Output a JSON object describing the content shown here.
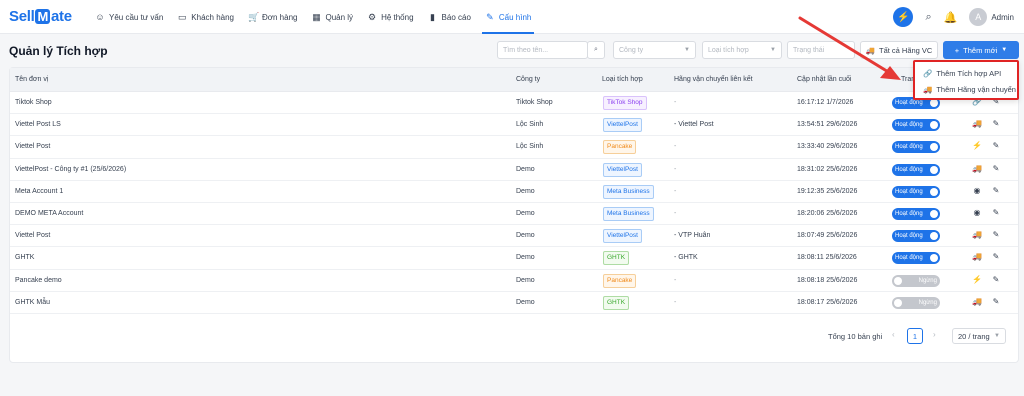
{
  "app": {
    "logo_part1": "Sell",
    "logo_m": "M",
    "logo_part2": "ate"
  },
  "nav": [
    {
      "icon": "☺",
      "icon_name": "smile-icon",
      "label": "Yêu cầu tư vấn"
    },
    {
      "icon": "▭",
      "icon_name": "customers-icon",
      "label": "Khách hàng"
    },
    {
      "icon": "🛒",
      "icon_name": "cart-icon",
      "label": "Đơn hàng"
    },
    {
      "icon": "▦",
      "icon_name": "grid-icon",
      "label": "Quản lý"
    },
    {
      "icon": "⚙",
      "icon_name": "settings-icon",
      "label": "Hệ thống"
    },
    {
      "icon": "▮",
      "icon_name": "report-icon",
      "label": "Báo cáo"
    },
    {
      "icon": "✎",
      "icon_name": "config-icon",
      "label": "Cấu hình"
    }
  ],
  "user": {
    "initial": "A",
    "name": "Admin"
  },
  "page": {
    "title": "Quản lý Tích hợp"
  },
  "filters": {
    "search_placeholder": "Tìm theo tên...",
    "company_placeholder": "Công ty",
    "type_placeholder": "Loại tích hợp",
    "status_placeholder": "Trạng thái",
    "carrier_button": "Tất cả Hãng VC",
    "new_button": "Thêm mới"
  },
  "table": {
    "headers": [
      "Tên đơn vị",
      "Công ty",
      "Loại tích hợp",
      "Hãng vận chuyển liên kết",
      "Cập nhật lần cuối",
      "Tran"
    ],
    "rows": [
      {
        "name": "Tiktok Shop",
        "company": "Tiktok Shop",
        "type": "TikTok Shop",
        "type_style": "purple",
        "carrier": "-",
        "updated": "16:17:12 1/7/2026",
        "status": "Hoạt động",
        "on": true,
        "act1": "🔗",
        "act1_name": "link-icon",
        "act2": "✎",
        "act2_name": "edit-icon"
      },
      {
        "name": "Viettel Post LS",
        "company": "Lộc Sinh",
        "type": "ViettelPost",
        "type_style": "blue",
        "carrier": "- Viettel Post",
        "updated": "13:54:51 29/6/2026",
        "status": "Hoạt động",
        "on": true,
        "act1": "🚚",
        "act1_name": "truck-icon",
        "act2": "✎",
        "act2_name": "edit-icon"
      },
      {
        "name": "Viettel Post",
        "company": "Lộc Sinh",
        "type": "Pancake",
        "type_style": "orange",
        "carrier": "-",
        "updated": "13:33:40 29/6/2026",
        "status": "Hoạt động",
        "on": true,
        "act1": "⚡",
        "act1_name": "bolt-icon",
        "act2": "✎",
        "act2_name": "edit-icon"
      },
      {
        "name": "ViettelPost - Công ty #1 (25/6/2026)",
        "company": "Demo",
        "type": "ViettelPost",
        "type_style": "blue",
        "carrier": "-",
        "updated": "18:31:02 25/6/2026",
        "status": "Hoạt động",
        "on": true,
        "act1": "🚚",
        "act1_name": "truck-icon",
        "act2": "✎",
        "act2_name": "edit-icon"
      },
      {
        "name": "Meta Account 1",
        "company": "Demo",
        "type": "Meta Business",
        "type_style": "blue",
        "carrier": "-",
        "updated": "19:12:35 25/6/2026",
        "status": "Hoạt động",
        "on": true,
        "act1": "◉",
        "act1_name": "view-icon",
        "act2": "✎",
        "act2_name": "edit-icon"
      },
      {
        "name": "DEMO META Account",
        "company": "Demo",
        "type": "Meta Business",
        "type_style": "blue",
        "carrier": "-",
        "updated": "18:20:06 25/6/2026",
        "status": "Hoạt động",
        "on": true,
        "act1": "◉",
        "act1_name": "view-icon",
        "act2": "✎",
        "act2_name": "edit-icon"
      },
      {
        "name": "Viettel Post",
        "company": "Demo",
        "type": "ViettelPost",
        "type_style": "blue",
        "carrier": "- VTP Huân",
        "updated": "18:07:49 25/6/2026",
        "status": "Hoạt động",
        "on": true,
        "act1": "🚚",
        "act1_name": "truck-icon",
        "act2": "✎",
        "act2_name": "edit-icon"
      },
      {
        "name": "GHTK",
        "company": "Demo",
        "type": "GHTK",
        "type_style": "green",
        "carrier": "- GHTK",
        "updated": "18:08:11 25/6/2026",
        "status": "Hoạt động",
        "on": true,
        "act1": "🚚",
        "act1_name": "truck-icon",
        "act2": "✎",
        "act2_name": "edit-icon"
      },
      {
        "name": "Pancake demo",
        "company": "Demo",
        "type": "Pancake",
        "type_style": "orange",
        "carrier": "-",
        "updated": "18:08:18 25/6/2026",
        "status": "Ngừng",
        "on": false,
        "act1": "⚡",
        "act1_name": "bolt-icon",
        "act2": "✎",
        "act2_name": "edit-icon"
      },
      {
        "name": "GHTK Mẫu",
        "company": "Demo",
        "type": "GHTK",
        "type_style": "green",
        "carrier": "-",
        "updated": "18:08:17 25/6/2026",
        "status": "Ngừng",
        "on": false,
        "act1": "🚚",
        "act1_name": "truck-icon",
        "act2": "✎",
        "act2_name": "edit-icon"
      }
    ]
  },
  "pagination": {
    "total": "Tổng 10 bản ghi",
    "current": "1",
    "page_size": "20 / trang"
  },
  "dropdown": {
    "items": [
      {
        "icon": "🔗",
        "label": "Thêm Tích hợp API"
      },
      {
        "icon": "🚚",
        "label": "Thêm Hãng vận chuyển"
      }
    ]
  },
  "colors": {
    "primary": "#1e73e8",
    "highlight": "#e02424",
    "switch_off": "#c4c7cd"
  }
}
